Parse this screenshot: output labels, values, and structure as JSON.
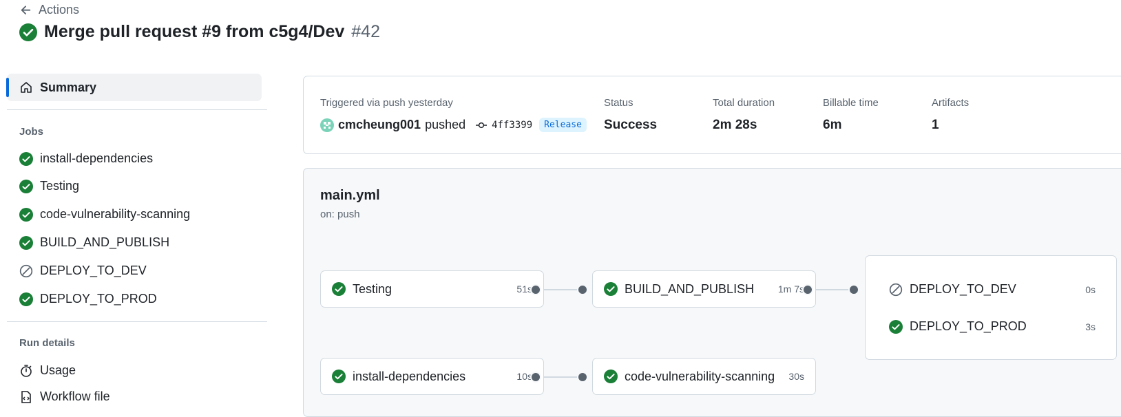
{
  "header": {
    "back_label": "Actions",
    "title": "Merge pull request #9 from c5g4/Dev",
    "run_number": "#42"
  },
  "sidebar": {
    "summary_label": "Summary",
    "jobs_heading": "Jobs",
    "jobs": [
      {
        "label": "install-dependencies",
        "status": "success"
      },
      {
        "label": "Testing",
        "status": "success"
      },
      {
        "label": "code-vulnerability-scanning",
        "status": "success"
      },
      {
        "label": "BUILD_AND_PUBLISH",
        "status": "success"
      },
      {
        "label": "DEPLOY_TO_DEV",
        "status": "skipped"
      },
      {
        "label": "DEPLOY_TO_PROD",
        "status": "success"
      }
    ],
    "run_details_heading": "Run details",
    "run_details": [
      {
        "label": "Usage",
        "icon": "stopwatch-icon"
      },
      {
        "label": "Workflow file",
        "icon": "file-code-icon"
      }
    ]
  },
  "summary": {
    "trigger_label": "Triggered via push yesterday",
    "actor": "cmcheung001",
    "action": "pushed",
    "commit_sha": "4ff3399",
    "branch_badge": "Release",
    "status_label": "Status",
    "status_value": "Success",
    "duration_label": "Total duration",
    "duration_value": "2m 28s",
    "billable_label": "Billable time",
    "billable_value": "6m",
    "artifacts_label": "Artifacts",
    "artifacts_value": "1"
  },
  "workflow": {
    "file": "main.yml",
    "trigger": "on: push",
    "jobs": {
      "testing": {
        "name": "Testing",
        "duration": "51s",
        "status": "success"
      },
      "build": {
        "name": "BUILD_AND_PUBLISH",
        "duration": "1m 7s",
        "status": "success"
      },
      "deploy_dev": {
        "name": "DEPLOY_TO_DEV",
        "duration": "0s",
        "status": "skipped"
      },
      "deploy_prod": {
        "name": "DEPLOY_TO_PROD",
        "duration": "3s",
        "status": "success"
      },
      "install": {
        "name": "install-dependencies",
        "duration": "10s",
        "status": "success"
      },
      "scan": {
        "name": "code-vulnerability-scanning",
        "duration": "30s",
        "status": "success"
      }
    }
  },
  "colors": {
    "success": "#1a7f37",
    "accent": "#0969da",
    "muted": "#59636e"
  }
}
